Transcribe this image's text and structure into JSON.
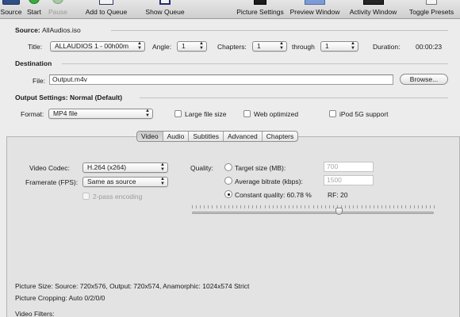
{
  "toolbar": {
    "source": "Source",
    "start": "Start",
    "pause": "Pause",
    "add_to_queue": "Add to Queue",
    "show_queue": "Show Queue",
    "picture_settings": "Picture Settings",
    "preview_window": "Preview Window",
    "activity_window": "Activity Window",
    "toggle_presets": "Toggle Presets"
  },
  "source": {
    "label": "Source:",
    "value": "AllAudios.iso",
    "title_label": "Title:",
    "title_value": "ALLAUDIOS 1 - 00h00m",
    "angle_label": "Angle:",
    "angle_value": "1",
    "chapters_label": "Chapters:",
    "chapters_from": "1",
    "through_label": "through",
    "chapters_to": "1",
    "duration_label": "Duration:",
    "duration_value": "00:00:23"
  },
  "destination": {
    "label": "Destination",
    "file_label": "File:",
    "file_value": "Output.m4v",
    "browse": "Browse..."
  },
  "output": {
    "label": "Output Settings:",
    "preset": "Normal (Default)",
    "format_label": "Format:",
    "format_value": "MP4 file",
    "large_file": "Large file size",
    "web_optimized": "Web optimized",
    "ipod": "iPod 5G support"
  },
  "tabs": [
    "Video",
    "Audio",
    "Subtitles",
    "Advanced",
    "Chapters"
  ],
  "video": {
    "codec_label": "Video Codec:",
    "codec_value": "H.264 (x264)",
    "framerate_label": "Framerate (FPS):",
    "framerate_value": "Same as source",
    "two_pass": "2-pass encoding",
    "quality_label": "Quality:",
    "target_size": "Target size (MB):",
    "target_size_value": "700",
    "avg_bitrate": "Average bitrate (kbps):",
    "avg_bitrate_value": "1500",
    "constant_quality": "Constant quality: 60.78 %",
    "rf": "RF: 20",
    "slider_position": 0.6078
  },
  "summary": {
    "picture_size": "Picture Size: Source: 720x576, Output: 720x574, Anamorphic: 1024x574 Strict",
    "picture_cropping": "Picture Cropping: Auto 0/2/0/0",
    "video_filters": "Video Filters:"
  }
}
